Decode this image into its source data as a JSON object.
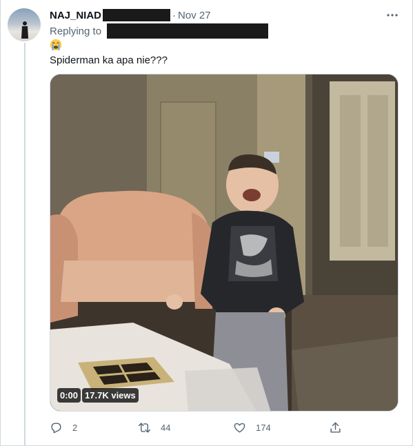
{
  "tweet": {
    "author_name": "NAJ_NIAD",
    "separator": "·",
    "date": "Nov 27",
    "replying_to_label": "Replying to",
    "emoji": "😭",
    "text": "Spiderman ka apa nie???"
  },
  "media": {
    "timestamp": "0:00",
    "views": "17.7K views"
  },
  "actions": {
    "replies": "2",
    "retweets": "44",
    "likes": "174"
  },
  "icons": {
    "more": "more-icon",
    "reply": "reply-icon",
    "retweet": "retweet-icon",
    "like": "like-icon",
    "share": "share-icon"
  },
  "colors": {
    "secondary_text": "#536471",
    "thread_line": "#cfd9de",
    "redaction": "#1a1a1a"
  }
}
